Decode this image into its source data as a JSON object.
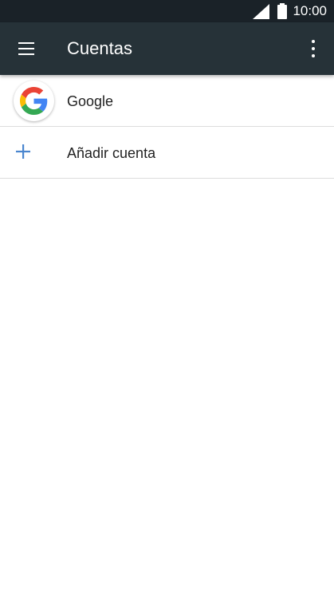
{
  "status_bar": {
    "time": "10:00",
    "icons": [
      "cell-signal-icon",
      "battery-icon"
    ]
  },
  "app_bar": {
    "title": "Cuentas",
    "menu_icon": "hamburger-menu-icon",
    "overflow_icon": "more-vert-icon",
    "background": "#263238"
  },
  "accounts": [
    {
      "label": "Google",
      "icon": "google-logo-icon"
    }
  ],
  "add_account": {
    "label": "Añadir cuenta",
    "icon": "plus-icon",
    "icon_color": "#4a86cf"
  }
}
